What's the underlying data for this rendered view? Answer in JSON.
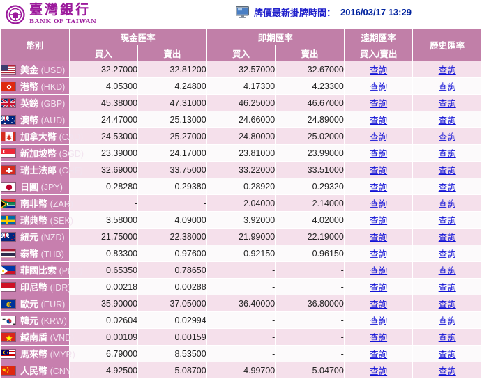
{
  "brand": {
    "name_cn": "臺灣銀行",
    "name_en": "BANK OF TAIWAN",
    "emblem_icon": "bot-circular-emblem-icon",
    "accent_color": "#9c1a9c"
  },
  "stamp": {
    "monitor_icon": "monitor-icon",
    "label": "牌價最新掛牌時間：",
    "datetime": "2016/03/17 13:29",
    "label_color": "#2222cc"
  },
  "theme": {
    "header_bg": "#c17fa8",
    "currency_col_bg": "#c77fae",
    "row_odd_bg": "#f5e0eb",
    "row_even_bg": "#fcfafb",
    "link_color": "#1313d6"
  },
  "table": {
    "headers": {
      "currency": "幣別",
      "cash_group": "現金匯率",
      "spot_group": "即期匯率",
      "forward_group": "遠期匯率",
      "history_group": "歷史匯率",
      "buy": "買入",
      "sell": "賣出",
      "buy_sell": "買入/賣出"
    },
    "link_label": "查詢",
    "dash": "-",
    "rows": [
      {
        "name": "美金",
        "code": "(USD)",
        "flag": "flag-us",
        "cash_buy": "32.27000",
        "cash_sell": "32.81200",
        "spot_buy": "32.57000",
        "spot_sell": "32.67000",
        "forward": "查詢",
        "history": "查詢"
      },
      {
        "name": "港幣",
        "code": "(HKD)",
        "flag": "flag-hk",
        "cash_buy": "4.05300",
        "cash_sell": "4.24800",
        "spot_buy": "4.17300",
        "spot_sell": "4.23300",
        "forward": "查詢",
        "history": "查詢"
      },
      {
        "name": "英鎊",
        "code": "(GBP)",
        "flag": "flag-gb",
        "cash_buy": "45.38000",
        "cash_sell": "47.31000",
        "spot_buy": "46.25000",
        "spot_sell": "46.67000",
        "forward": "查詢",
        "history": "查詢"
      },
      {
        "name": "澳幣",
        "code": "(AUD)",
        "flag": "flag-au",
        "cash_buy": "24.47000",
        "cash_sell": "25.13000",
        "spot_buy": "24.66000",
        "spot_sell": "24.89000",
        "forward": "查詢",
        "history": "查詢"
      },
      {
        "name": "加拿大幣",
        "code": "(CAD)",
        "flag": "flag-ca",
        "cash_buy": "24.53000",
        "cash_sell": "25.27000",
        "spot_buy": "24.80000",
        "spot_sell": "25.02000",
        "forward": "查詢",
        "history": "查詢"
      },
      {
        "name": "新加坡幣",
        "code": "(SGD)",
        "flag": "flag-sg",
        "cash_buy": "23.39000",
        "cash_sell": "24.17000",
        "spot_buy": "23.81000",
        "spot_sell": "23.99000",
        "forward": "查詢",
        "history": "查詢"
      },
      {
        "name": "瑞士法郎",
        "code": "(CHF)",
        "flag": "flag-ch",
        "cash_buy": "32.69000",
        "cash_sell": "33.75000",
        "spot_buy": "33.22000",
        "spot_sell": "33.51000",
        "forward": "查詢",
        "history": "查詢"
      },
      {
        "name": "日圓",
        "code": "(JPY)",
        "flag": "flag-jp",
        "cash_buy": "0.28280",
        "cash_sell": "0.29380",
        "spot_buy": "0.28920",
        "spot_sell": "0.29320",
        "forward": "查詢",
        "history": "查詢"
      },
      {
        "name": "南非幣",
        "code": "(ZAR)",
        "flag": "flag-za",
        "cash_buy": "-",
        "cash_sell": "-",
        "spot_buy": "2.04000",
        "spot_sell": "2.14000",
        "forward": "查詢",
        "history": "查詢"
      },
      {
        "name": "瑞典幣",
        "code": "(SEK)",
        "flag": "flag-se",
        "cash_buy": "3.58000",
        "cash_sell": "4.09000",
        "spot_buy": "3.92000",
        "spot_sell": "4.02000",
        "forward": "查詢",
        "history": "查詢"
      },
      {
        "name": "紐元",
        "code": "(NZD)",
        "flag": "flag-nz",
        "cash_buy": "21.75000",
        "cash_sell": "22.38000",
        "spot_buy": "21.99000",
        "spot_sell": "22.19000",
        "forward": "查詢",
        "history": "查詢"
      },
      {
        "name": "泰幣",
        "code": "(THB)",
        "flag": "flag-th",
        "cash_buy": "0.83300",
        "cash_sell": "0.97600",
        "spot_buy": "0.92150",
        "spot_sell": "0.96150",
        "forward": "查詢",
        "history": "查詢"
      },
      {
        "name": "菲國比索",
        "code": "(PHP)",
        "flag": "flag-ph",
        "cash_buy": "0.65350",
        "cash_sell": "0.78650",
        "spot_buy": "-",
        "spot_sell": "-",
        "forward": "查詢",
        "history": "查詢"
      },
      {
        "name": "印尼幣",
        "code": "(IDR)",
        "flag": "flag-id",
        "cash_buy": "0.00218",
        "cash_sell": "0.00288",
        "spot_buy": "-",
        "spot_sell": "-",
        "forward": "查詢",
        "history": "查詢"
      },
      {
        "name": "歐元",
        "code": "(EUR)",
        "flag": "flag-eu",
        "cash_buy": "35.90000",
        "cash_sell": "37.05000",
        "spot_buy": "36.40000",
        "spot_sell": "36.80000",
        "forward": "查詢",
        "history": "查詢"
      },
      {
        "name": "韓元",
        "code": "(KRW)",
        "flag": "flag-kr",
        "cash_buy": "0.02604",
        "cash_sell": "0.02994",
        "spot_buy": "-",
        "spot_sell": "-",
        "forward": "查詢",
        "history": "查詢"
      },
      {
        "name": "越南盾",
        "code": "(VND)",
        "flag": "flag-vn",
        "cash_buy": "0.00109",
        "cash_sell": "0.00159",
        "spot_buy": "-",
        "spot_sell": "-",
        "forward": "查詢",
        "history": "查詢"
      },
      {
        "name": "馬來幣",
        "code": "(MYR)",
        "flag": "flag-my",
        "cash_buy": "6.79000",
        "cash_sell": "8.53500",
        "spot_buy": "-",
        "spot_sell": "-",
        "forward": "查詢",
        "history": "查詢"
      },
      {
        "name": "人民幣",
        "code": "(CNY)",
        "flag": "flag-cn",
        "cash_buy": "4.92500",
        "cash_sell": "5.08700",
        "spot_buy": "4.99700",
        "spot_sell": "5.04700",
        "forward": "查詢",
        "history": "查詢"
      }
    ]
  }
}
